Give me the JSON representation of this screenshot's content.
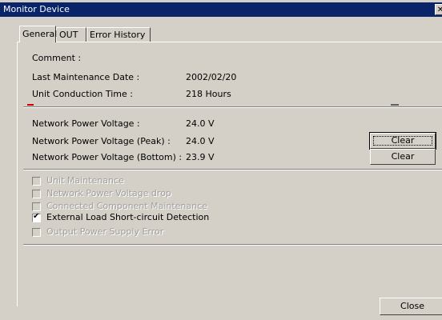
{
  "window": {
    "title": "Monitor Device"
  },
  "tabs": [
    {
      "label": "General",
      "active": true
    },
    {
      "label": "OUT",
      "active": false
    },
    {
      "label": "Error History",
      "active": false
    }
  ],
  "info": {
    "comment_label": "Comment :",
    "last_maintenance_label": "Last Maintenance Date :",
    "last_maintenance_value": "2002/02/20",
    "conduction_label": "Unit Conduction Time :",
    "conduction_value": "218 Hours"
  },
  "voltage": {
    "network_label": "Network Power Voltage :",
    "network_value": "24.0 V",
    "peak_label": "Network Power Voltage (Peak) :",
    "peak_value": "24.0 V",
    "bottom_label": "Network Power Voltage (Bottom) :",
    "bottom_value": "23.9 V",
    "clear_peak_label": "Clear",
    "clear_bottom_label": "Clear"
  },
  "checks": [
    {
      "label": "Unit Maintenance",
      "checked": false,
      "enabled": false
    },
    {
      "label": "Network Power Voltage drop",
      "checked": false,
      "enabled": false
    },
    {
      "label": "Connected Component Maintenance",
      "checked": false,
      "enabled": false
    },
    {
      "label": "External Load Short-circuit Detection",
      "checked": true,
      "enabled": true
    },
    {
      "label": "Output Power Supply Error",
      "checked": false,
      "enabled": false
    }
  ],
  "footer": {
    "close_label": "Close"
  },
  "colors": {
    "titlebar": "#0a246a",
    "face": "#d4d0c8",
    "disabled_text": "#a0a0a0"
  }
}
